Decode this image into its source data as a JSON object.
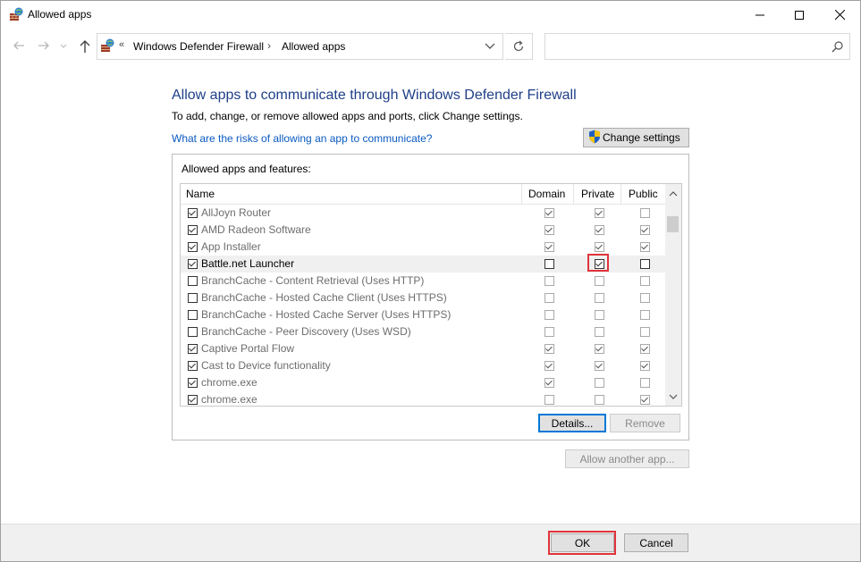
{
  "window": {
    "title": "Allowed apps",
    "controls": {
      "minimize": "—",
      "maximize": "☐",
      "close": "✕"
    }
  },
  "address_bar": {
    "prefix": "«",
    "segments": [
      "Windows Defender Firewall",
      "Allowed apps"
    ],
    "separator": "›"
  },
  "search": {
    "placeholder": "",
    "value": ""
  },
  "content": {
    "heading": "Allow apps to communicate through Windows Defender Firewall",
    "subtext": "To add, change, or remove allowed apps and ports, click Change settings.",
    "risk_link": "What are the risks of allowing an app to communicate?",
    "change_settings_label": "Change settings",
    "group_label": "Allowed apps and features:",
    "columns": {
      "name": "Name",
      "domain": "Domain",
      "private": "Private",
      "public": "Public"
    },
    "rows": [
      {
        "name": "AllJoyn Router",
        "enabled": true,
        "domain": true,
        "private": true,
        "public": false
      },
      {
        "name": "AMD Radeon Software",
        "enabled": true,
        "domain": true,
        "private": true,
        "public": true
      },
      {
        "name": "App Installer",
        "enabled": true,
        "domain": true,
        "private": true,
        "public": true
      },
      {
        "name": "Battle.net Launcher",
        "enabled": true,
        "domain": false,
        "private": true,
        "public": false,
        "selected": true
      },
      {
        "name": "BranchCache - Content Retrieval (Uses HTTP)",
        "enabled": false,
        "domain": false,
        "private": false,
        "public": false
      },
      {
        "name": "BranchCache - Hosted Cache Client (Uses HTTPS)",
        "enabled": false,
        "domain": false,
        "private": false,
        "public": false
      },
      {
        "name": "BranchCache - Hosted Cache Server (Uses HTTPS)",
        "enabled": false,
        "domain": false,
        "private": false,
        "public": false
      },
      {
        "name": "BranchCache - Peer Discovery (Uses WSD)",
        "enabled": false,
        "domain": false,
        "private": false,
        "public": false
      },
      {
        "name": "Captive Portal Flow",
        "enabled": true,
        "domain": true,
        "private": true,
        "public": true
      },
      {
        "name": "Cast to Device functionality",
        "enabled": true,
        "domain": true,
        "private": true,
        "public": true
      },
      {
        "name": "chrome.exe",
        "enabled": true,
        "domain": true,
        "private": false,
        "public": false
      },
      {
        "name": "chrome.exe",
        "enabled": true,
        "domain": false,
        "private": false,
        "public": true
      }
    ],
    "details_label": "Details...",
    "remove_label": "Remove",
    "allow_another_label": "Allow another app..."
  },
  "footer": {
    "ok_label": "OK",
    "cancel_label": "Cancel"
  },
  "colors": {
    "heading": "#1e3f88",
    "link": "#0a5ac2",
    "highlight": "#e0343a",
    "focus": "#0078d7"
  },
  "icons": [
    "firewall-icon",
    "back-arrow-icon",
    "forward-arrow-icon",
    "up-arrow-icon",
    "refresh-icon",
    "search-icon",
    "shield-icon",
    "chevron-down-icon"
  ]
}
